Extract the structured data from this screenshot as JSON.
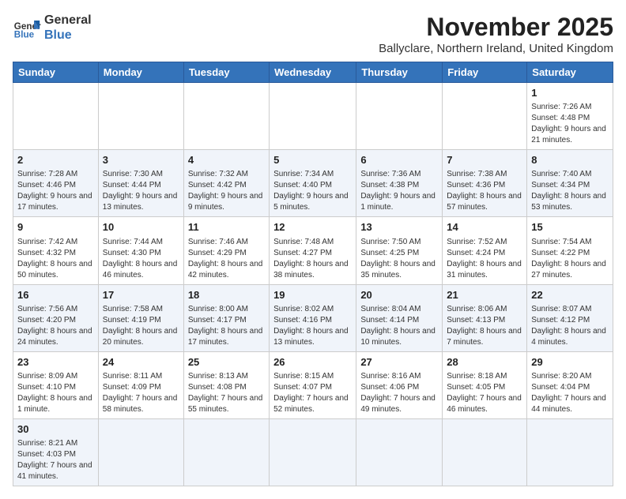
{
  "header": {
    "logo_general": "General",
    "logo_blue": "Blue",
    "month_title": "November 2025",
    "location": "Ballyclare, Northern Ireland, United Kingdom"
  },
  "days_of_week": [
    "Sunday",
    "Monday",
    "Tuesday",
    "Wednesday",
    "Thursday",
    "Friday",
    "Saturday"
  ],
  "weeks": [
    [
      {
        "day": "",
        "info": ""
      },
      {
        "day": "",
        "info": ""
      },
      {
        "day": "",
        "info": ""
      },
      {
        "day": "",
        "info": ""
      },
      {
        "day": "",
        "info": ""
      },
      {
        "day": "",
        "info": ""
      },
      {
        "day": "1",
        "info": "Sunrise: 7:26 AM\nSunset: 4:48 PM\nDaylight: 9 hours and 21 minutes."
      }
    ],
    [
      {
        "day": "2",
        "info": "Sunrise: 7:28 AM\nSunset: 4:46 PM\nDaylight: 9 hours and 17 minutes."
      },
      {
        "day": "3",
        "info": "Sunrise: 7:30 AM\nSunset: 4:44 PM\nDaylight: 9 hours and 13 minutes."
      },
      {
        "day": "4",
        "info": "Sunrise: 7:32 AM\nSunset: 4:42 PM\nDaylight: 9 hours and 9 minutes."
      },
      {
        "day": "5",
        "info": "Sunrise: 7:34 AM\nSunset: 4:40 PM\nDaylight: 9 hours and 5 minutes."
      },
      {
        "day": "6",
        "info": "Sunrise: 7:36 AM\nSunset: 4:38 PM\nDaylight: 9 hours and 1 minute."
      },
      {
        "day": "7",
        "info": "Sunrise: 7:38 AM\nSunset: 4:36 PM\nDaylight: 8 hours and 57 minutes."
      },
      {
        "day": "8",
        "info": "Sunrise: 7:40 AM\nSunset: 4:34 PM\nDaylight: 8 hours and 53 minutes."
      }
    ],
    [
      {
        "day": "9",
        "info": "Sunrise: 7:42 AM\nSunset: 4:32 PM\nDaylight: 8 hours and 50 minutes."
      },
      {
        "day": "10",
        "info": "Sunrise: 7:44 AM\nSunset: 4:30 PM\nDaylight: 8 hours and 46 minutes."
      },
      {
        "day": "11",
        "info": "Sunrise: 7:46 AM\nSunset: 4:29 PM\nDaylight: 8 hours and 42 minutes."
      },
      {
        "day": "12",
        "info": "Sunrise: 7:48 AM\nSunset: 4:27 PM\nDaylight: 8 hours and 38 minutes."
      },
      {
        "day": "13",
        "info": "Sunrise: 7:50 AM\nSunset: 4:25 PM\nDaylight: 8 hours and 35 minutes."
      },
      {
        "day": "14",
        "info": "Sunrise: 7:52 AM\nSunset: 4:24 PM\nDaylight: 8 hours and 31 minutes."
      },
      {
        "day": "15",
        "info": "Sunrise: 7:54 AM\nSunset: 4:22 PM\nDaylight: 8 hours and 27 minutes."
      }
    ],
    [
      {
        "day": "16",
        "info": "Sunrise: 7:56 AM\nSunset: 4:20 PM\nDaylight: 8 hours and 24 minutes."
      },
      {
        "day": "17",
        "info": "Sunrise: 7:58 AM\nSunset: 4:19 PM\nDaylight: 8 hours and 20 minutes."
      },
      {
        "day": "18",
        "info": "Sunrise: 8:00 AM\nSunset: 4:17 PM\nDaylight: 8 hours and 17 minutes."
      },
      {
        "day": "19",
        "info": "Sunrise: 8:02 AM\nSunset: 4:16 PM\nDaylight: 8 hours and 13 minutes."
      },
      {
        "day": "20",
        "info": "Sunrise: 8:04 AM\nSunset: 4:14 PM\nDaylight: 8 hours and 10 minutes."
      },
      {
        "day": "21",
        "info": "Sunrise: 8:06 AM\nSunset: 4:13 PM\nDaylight: 8 hours and 7 minutes."
      },
      {
        "day": "22",
        "info": "Sunrise: 8:07 AM\nSunset: 4:12 PM\nDaylight: 8 hours and 4 minutes."
      }
    ],
    [
      {
        "day": "23",
        "info": "Sunrise: 8:09 AM\nSunset: 4:10 PM\nDaylight: 8 hours and 1 minute."
      },
      {
        "day": "24",
        "info": "Sunrise: 8:11 AM\nSunset: 4:09 PM\nDaylight: 7 hours and 58 minutes."
      },
      {
        "day": "25",
        "info": "Sunrise: 8:13 AM\nSunset: 4:08 PM\nDaylight: 7 hours and 55 minutes."
      },
      {
        "day": "26",
        "info": "Sunrise: 8:15 AM\nSunset: 4:07 PM\nDaylight: 7 hours and 52 minutes."
      },
      {
        "day": "27",
        "info": "Sunrise: 8:16 AM\nSunset: 4:06 PM\nDaylight: 7 hours and 49 minutes."
      },
      {
        "day": "28",
        "info": "Sunrise: 8:18 AM\nSunset: 4:05 PM\nDaylight: 7 hours and 46 minutes."
      },
      {
        "day": "29",
        "info": "Sunrise: 8:20 AM\nSunset: 4:04 PM\nDaylight: 7 hours and 44 minutes."
      }
    ],
    [
      {
        "day": "30",
        "info": "Sunrise: 8:21 AM\nSunset: 4:03 PM\nDaylight: 7 hours and 41 minutes."
      },
      {
        "day": "",
        "info": ""
      },
      {
        "day": "",
        "info": ""
      },
      {
        "day": "",
        "info": ""
      },
      {
        "day": "",
        "info": ""
      },
      {
        "day": "",
        "info": ""
      },
      {
        "day": "",
        "info": ""
      }
    ]
  ]
}
